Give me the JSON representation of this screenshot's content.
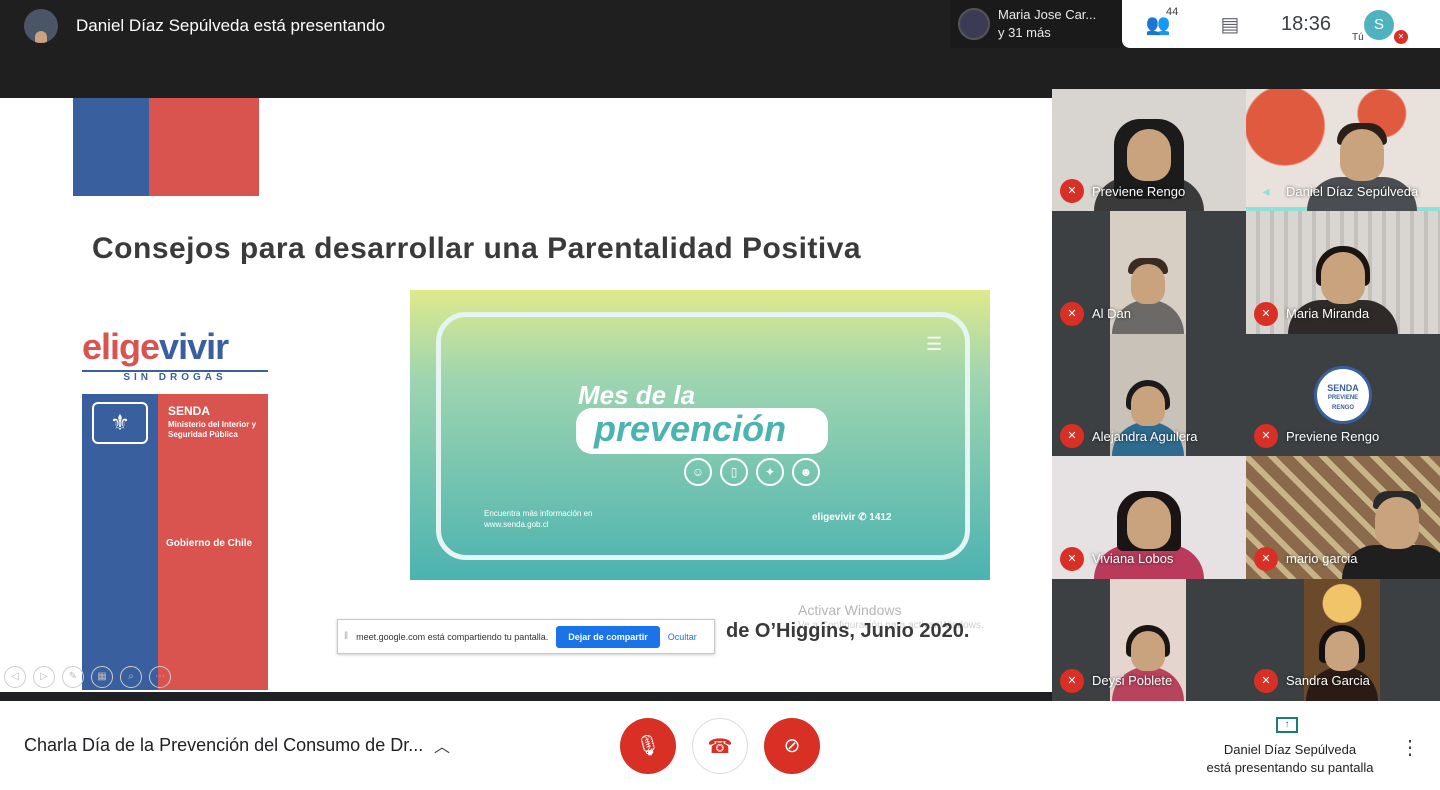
{
  "header": {
    "presenter_text": "Daniel Díaz Sepúlveda está presentando",
    "others_name": "Maria Jose Car...",
    "others_more": "y 31 más",
    "participants_count": "44",
    "clock": "18:36",
    "me_initial": "S",
    "me_label": "Tú"
  },
  "slide": {
    "title": "Consejos para desarrollar una Parentalidad Positiva",
    "logo_part_a": "elige",
    "logo_part_b": "vivir",
    "sin_drogas": "SIN DROGAS",
    "senda": "SENDA",
    "ministerio": "Ministerio del Interior y Seguridad Pública",
    "gobierno": "Gobierno de Chile",
    "banner_mes": "Mes de la",
    "banner_prevencion": "prevención",
    "banner_encuentra": "Encuentra más información en",
    "banner_url": "www.senda.gob.cl",
    "banner_logos": "eligevivir   ✆ 1412",
    "footer_region": "de O’Higgins, Junio 2020.",
    "activar": "Activar Windows",
    "activar_sub": "Ve a Configuración para activar Windows."
  },
  "sharebar": {
    "message": "meet.google.com está compartiendo tu pantalla.",
    "stop_label": "Dejar de compartir",
    "hide_label": "Ocultar"
  },
  "tiles": [
    {
      "name": "Previene Rengo",
      "muted": true
    },
    {
      "name": "Daniel Díaz Sepúlveda",
      "muted": false
    },
    {
      "name": "Al Dan",
      "muted": true
    },
    {
      "name": "Maria Miranda",
      "muted": true
    },
    {
      "name": "Alejandra Aguilera",
      "muted": true
    },
    {
      "name": "Previene Rengo",
      "muted": true
    },
    {
      "name": "Viviana Lobos",
      "muted": true
    },
    {
      "name": "mario garcia",
      "muted": true
    },
    {
      "name": "Deysi Poblete",
      "muted": true
    },
    {
      "name": "Sandra Garcia",
      "muted": true
    }
  ],
  "senda_badge": {
    "line1": "SENDA",
    "line2": "PREVIENE",
    "line3": "RENGO"
  },
  "footer": {
    "meeting_title": "Charla Día de la Prevención del Consumo de Dr...",
    "presenting_line1": "Daniel Díaz Sepúlveda",
    "presenting_line2": "está presentando su pantalla"
  },
  "colors": {
    "muted_red": "#d93025",
    "chile_blue": "#3a5f9e",
    "chile_red": "#d9534f",
    "teal_accent": "#8ee1d8"
  }
}
